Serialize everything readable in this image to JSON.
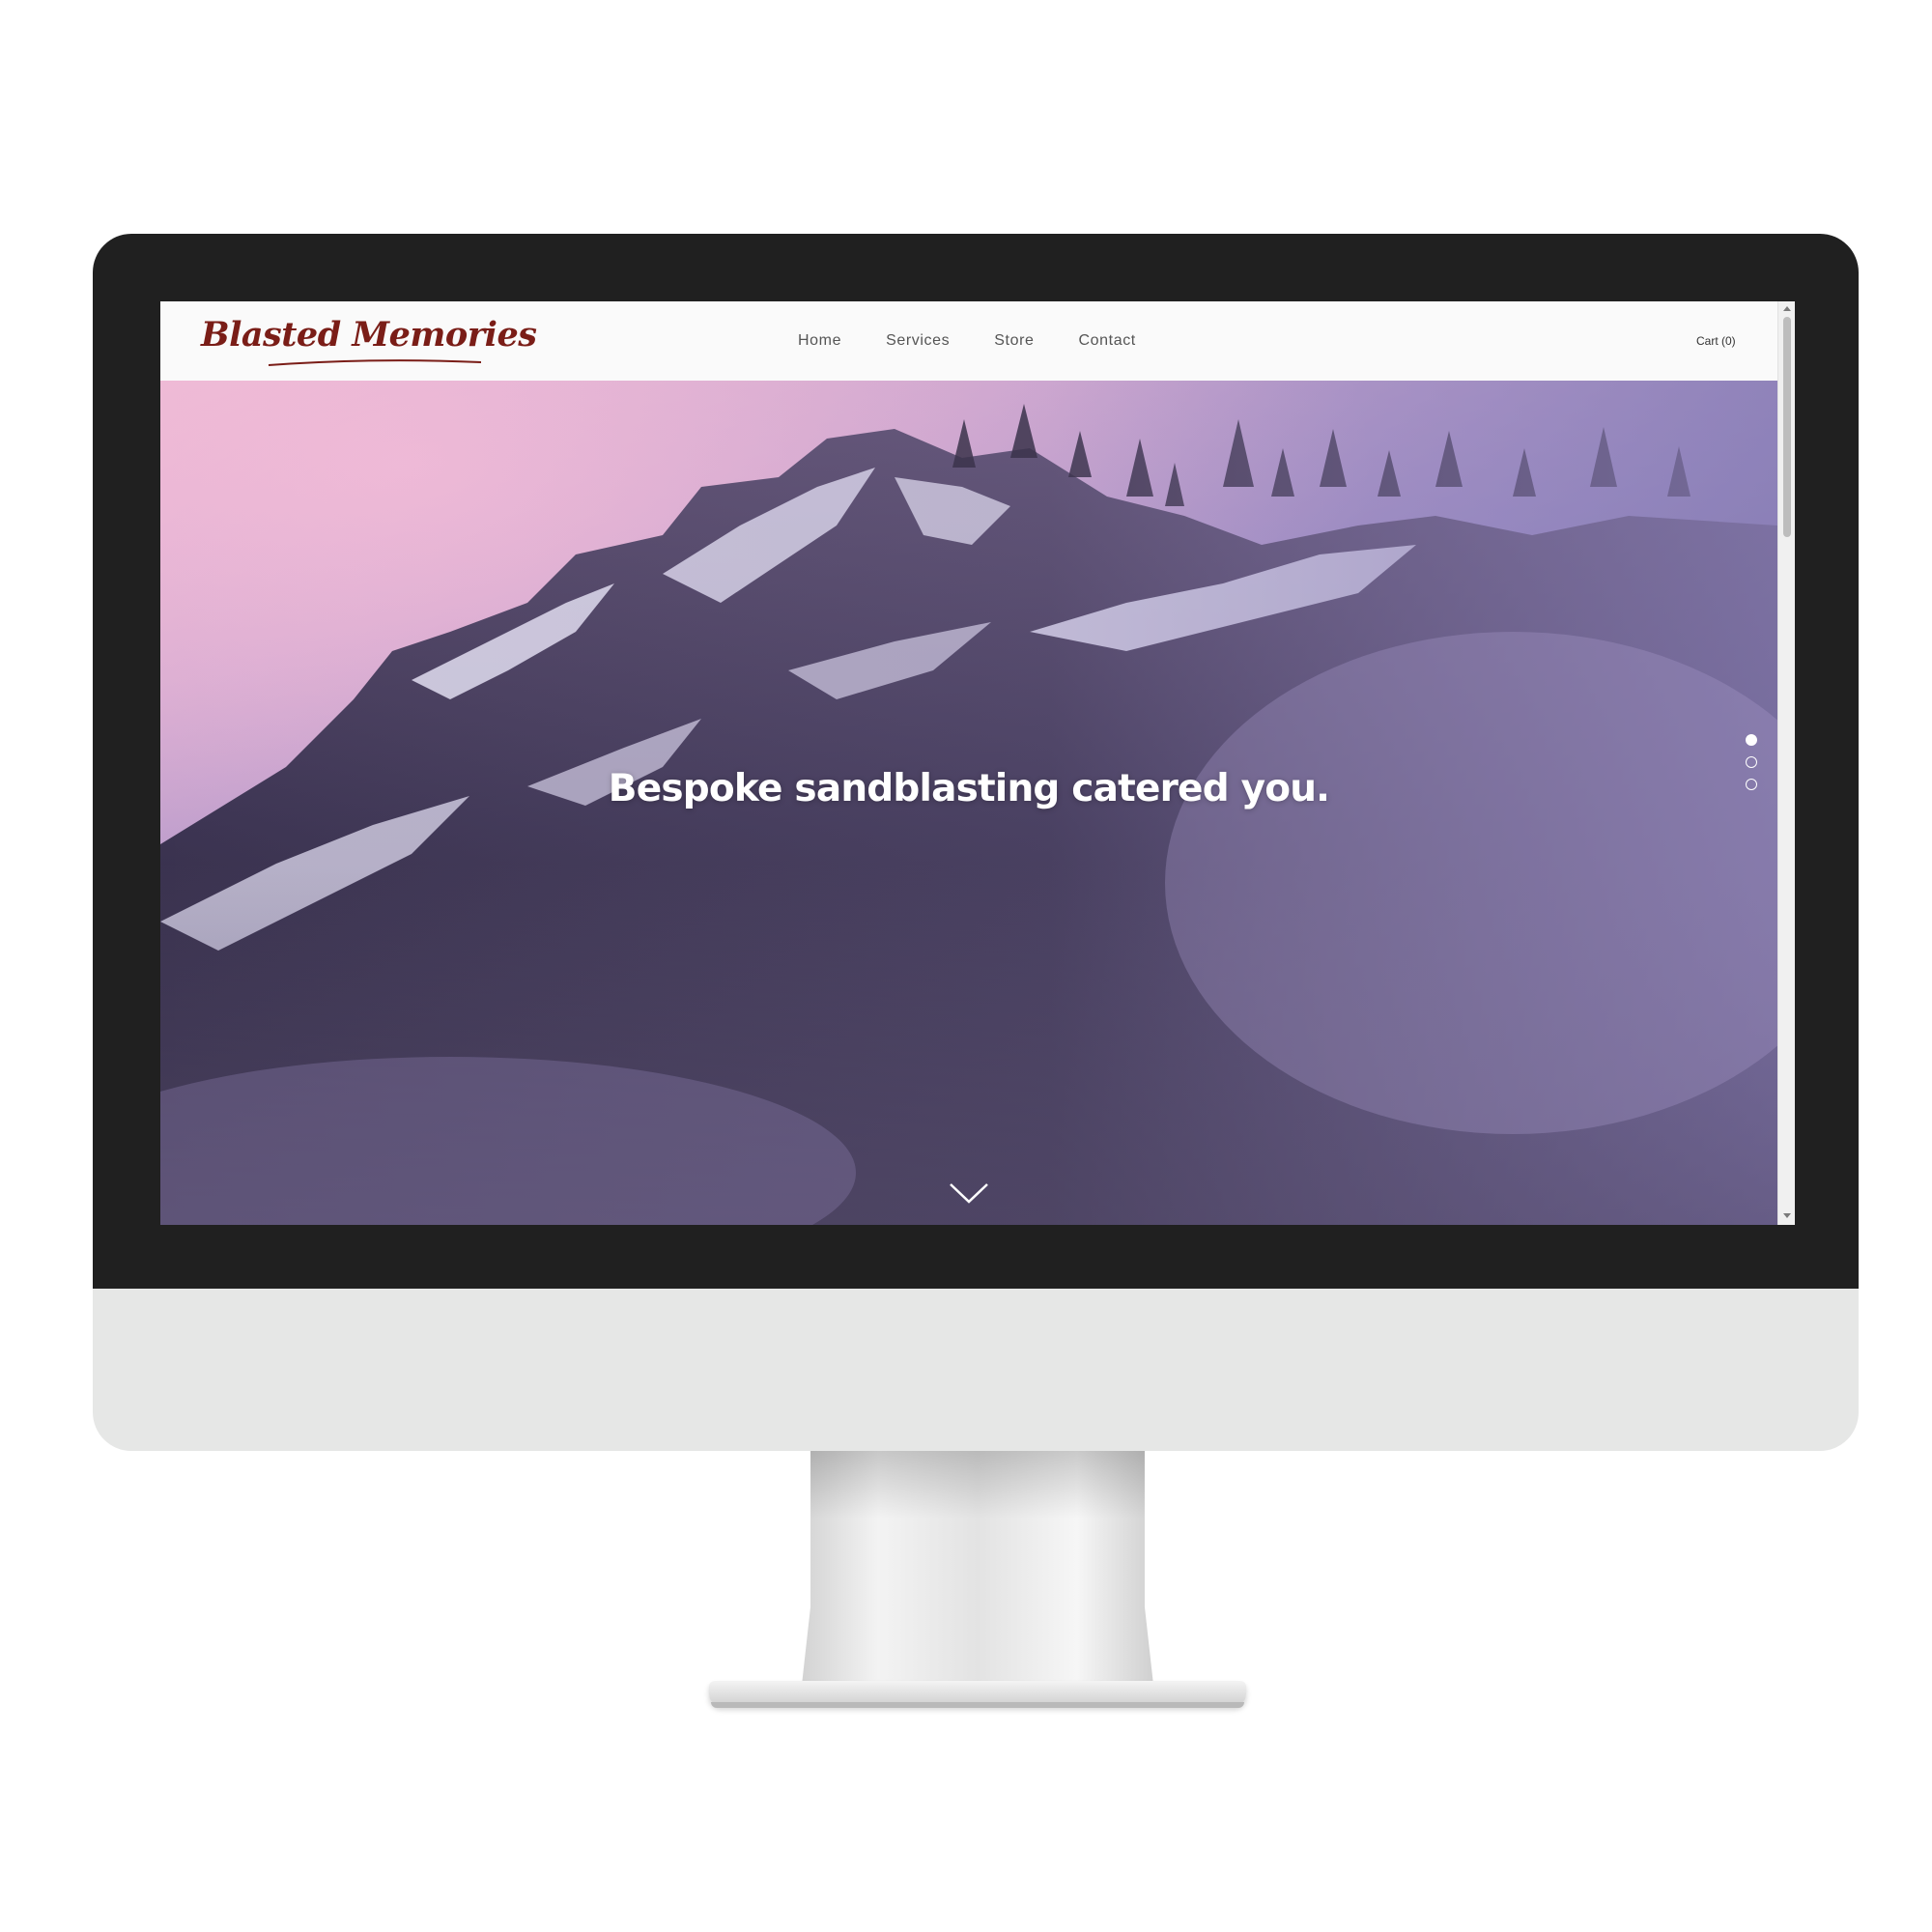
{
  "site": {
    "logo_text": "Blasted Memories",
    "nav": [
      {
        "label": "Home"
      },
      {
        "label": "Services"
      },
      {
        "label": "Store"
      },
      {
        "label": "Contact"
      }
    ],
    "cart_label": "Cart (0)"
  },
  "hero": {
    "headline": "Bespoke sandblasting catered you.",
    "slide_count": 3,
    "active_slide": 1,
    "scroll_icon": "chevron-down-icon"
  },
  "colors": {
    "logo": "#7a1d17",
    "header_bg": "#fafafa",
    "nav_text": "#555555",
    "bezel": "#202020",
    "chin": "#e6e7e6"
  }
}
